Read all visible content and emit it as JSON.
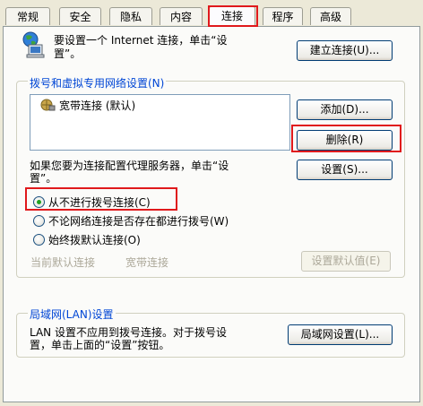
{
  "tabs": [
    {
      "label": "常规"
    },
    {
      "label": "安全"
    },
    {
      "label": "隐私"
    },
    {
      "label": "内容"
    },
    {
      "label": "连接"
    },
    {
      "label": "程序"
    },
    {
      "label": "高级"
    }
  ],
  "active_tab": "连接",
  "setup": {
    "text_line1": "要设置一个 Internet 连接，单击“设",
    "text_line2": "置”。",
    "button": "建立连接(U)..."
  },
  "dialup": {
    "group_label": "拨号和虚拟专用网络设置(N)",
    "connections": [
      {
        "name": "宽带连接 (默认)"
      }
    ],
    "add_button": "添加(D)...",
    "remove_button": "删除(R)",
    "settings_button": "设置(S)...",
    "proxy_text_line1": "如果您要为连接配置代理服务器，单击“设",
    "proxy_text_line2": "置”。",
    "options": [
      {
        "label": "从不进行拨号连接(C)",
        "checked": true
      },
      {
        "label": "不论网络连接是否存在都进行拨号(W)",
        "checked": false
      },
      {
        "label": "始终拨默认连接(O)",
        "checked": false
      }
    ],
    "current_default_label": "当前默认连接",
    "current_default_value": "宽带连接",
    "set_default_button": "设置默认值(E)"
  },
  "lan": {
    "group_label": "局域网(LAN)设置",
    "text_line1": "LAN 设置不应用到拨号连接。对于拨号设",
    "text_line2": "置，单击上面的“设置”按钮。",
    "button": "局域网设置(L)..."
  },
  "colors": {
    "highlight_box": "#e0191c",
    "group_label": "#0046d5",
    "active_tab_top": "#e68b2c"
  }
}
